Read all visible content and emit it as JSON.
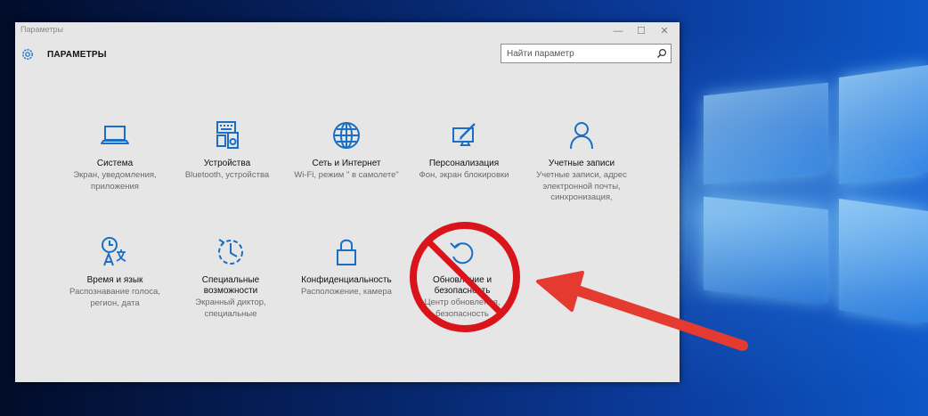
{
  "window": {
    "title": "Параметры",
    "header_title": "ПАРАМЕТРЫ",
    "controls": {
      "minimize": "—",
      "maximize": "☐",
      "close": "✕"
    }
  },
  "search": {
    "placeholder": "Найти параметр"
  },
  "tiles": [
    {
      "name": "Система",
      "desc": "Экран, уведомления, приложения",
      "icon": "laptop-icon"
    },
    {
      "name": "Устройства",
      "desc": "Bluetooth, устройства",
      "icon": "devices-icon"
    },
    {
      "name": "Сеть и Интернет",
      "desc": "Wi-Fi, режим \" в самолете\"",
      "icon": "globe-icon"
    },
    {
      "name": "Персонализация",
      "desc": "Фон, экран блокировки",
      "icon": "personalization-icon"
    },
    {
      "name": "Учетные записи",
      "desc": "Учетные записи, адрес электронной почты, синхронизация,",
      "icon": "person-icon"
    },
    {
      "name": "Время и язык",
      "desc": "Распознавание голоса, регион, дата",
      "icon": "time-language-icon"
    },
    {
      "name": "Специальные возможности",
      "desc": "Экранный диктор, специальные",
      "icon": "accessibility-icon"
    },
    {
      "name": "Конфиденциальность",
      "desc": "Расположение, камера",
      "icon": "lock-icon"
    },
    {
      "name": "Обновление и безопасность",
      "desc": "Центр обновления, безопасность",
      "icon": "update-icon"
    }
  ],
  "annotations": {
    "prohibited_color": "#d9141b",
    "arrow_color": "#e53a2f"
  },
  "colors": {
    "accent": "#1a6fc4",
    "window_bg": "#e6e6e6"
  }
}
